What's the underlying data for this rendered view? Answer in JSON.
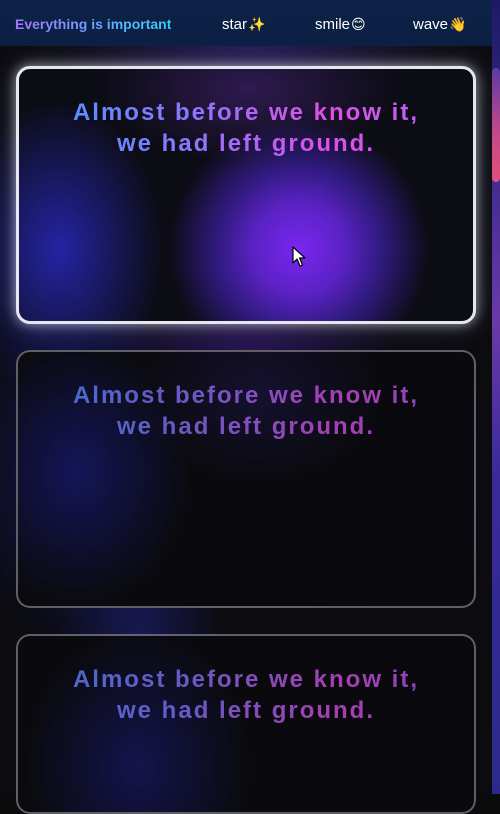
{
  "nav": {
    "brand": "Everything is important",
    "links": [
      {
        "label": "star",
        "emoji": "✨"
      },
      {
        "label": "smile",
        "emoji": "😊"
      },
      {
        "label": "wave",
        "emoji": "👋"
      }
    ]
  },
  "cards": [
    {
      "line1": "Almost before we know it,",
      "line2": "we had left ground."
    },
    {
      "line1": "Almost before we know it,",
      "line2": "we had left ground."
    },
    {
      "line1": "Almost before we know it,",
      "line2": "we had left ground."
    }
  ],
  "colors": {
    "nav_bg": "#0a1f42",
    "accent_purple": "#7a26f0",
    "gradient_blue": "#4a96ff",
    "gradient_pink": "#e04fe6"
  },
  "icons": [
    "sparkles-icon",
    "smiling-face-icon",
    "waving-hand-icon",
    "mouse-cursor-icon"
  ]
}
